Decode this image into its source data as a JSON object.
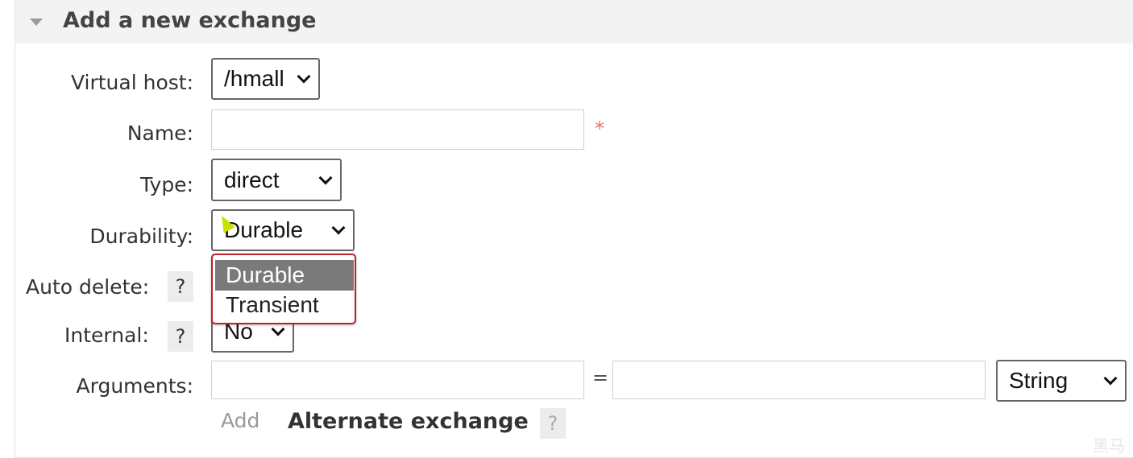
{
  "panel": {
    "title": "Add a new exchange"
  },
  "form": {
    "virtual_host": {
      "label": "Virtual host:",
      "value": "/hmall"
    },
    "name": {
      "label": "Name:",
      "value": "",
      "required_mark": "*"
    },
    "type": {
      "label": "Type:",
      "value": "direct"
    },
    "durability": {
      "label": "Durability:",
      "value": "Durable",
      "options": [
        "Durable",
        "Transient"
      ],
      "highlighted_option": "Durable"
    },
    "auto_delete": {
      "label": "Auto delete:",
      "help": "?"
    },
    "internal": {
      "label": "Internal:",
      "help": "?",
      "value": "No"
    },
    "arguments": {
      "label": "Arguments:",
      "key_value": "",
      "equals": "=",
      "value_value": "",
      "type_value": "String",
      "add_link": "Add",
      "alternate_exchange": "Alternate exchange",
      "alternate_help": "?"
    }
  },
  "watermark": "黑马"
}
